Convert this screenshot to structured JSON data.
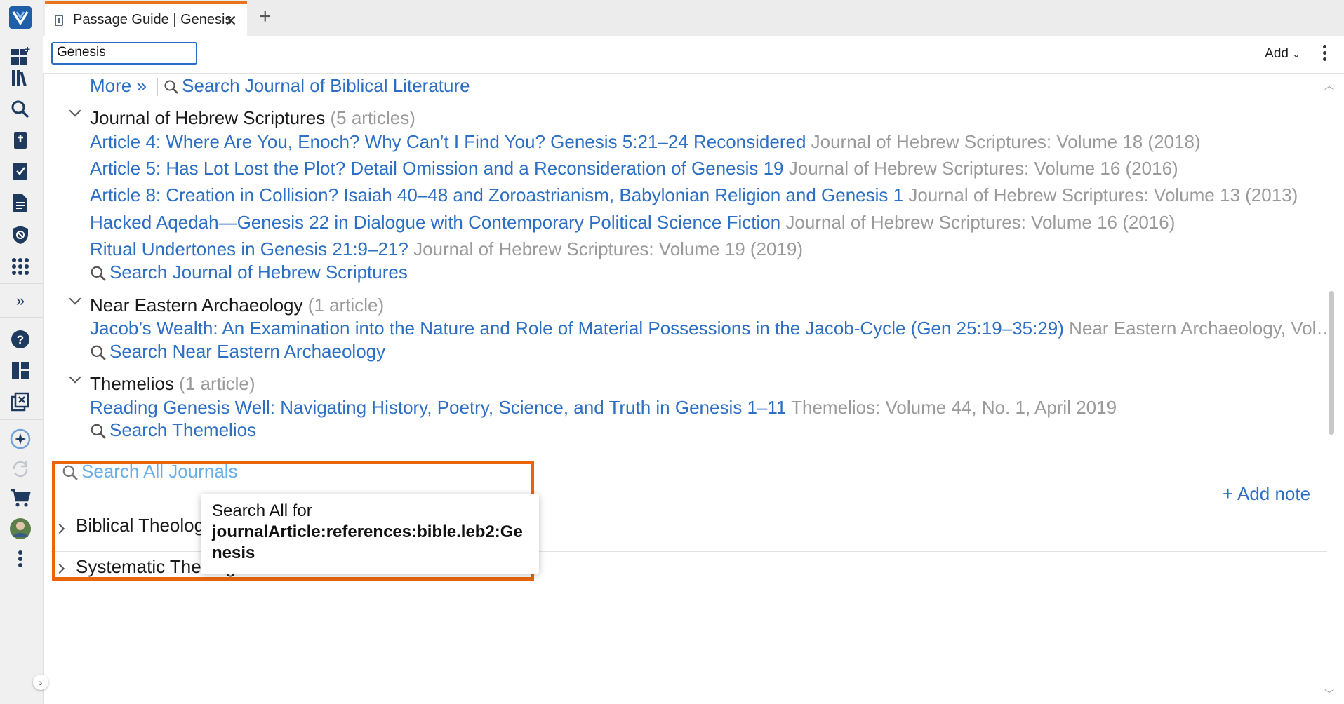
{
  "tab": {
    "title": "Passage Guide | Genesis",
    "close": "✕",
    "new_tab": "+"
  },
  "toolbar": {
    "reference": "Genesis",
    "add_label": "Add"
  },
  "content": {
    "jbl_more": "More »",
    "jbl_search": "Search Journal of Biblical Literature",
    "jhs": {
      "name": "Journal of Hebrew Scriptures",
      "count": "(5 articles)",
      "articles": [
        {
          "title": "Article 4: Where Are You, Enoch? Why Can’t I Find You? Genesis 5:21–24 Reconsidered",
          "source": "Journal of Hebrew Scriptures: Volume 18 (2018)"
        },
        {
          "title": "Article 5: Has Lot Lost the Plot? Detail Omission and a Reconsideration of Genesis 19",
          "source": "Journal of Hebrew Scriptures: Volume 16 (2016)"
        },
        {
          "title": "Article 8: Creation in Collision? Isaiah 40–48 and Zoroastrianism, Babylonian Religion and Genesis 1",
          "source": "Journal of Hebrew Scriptures: Volume 13 (2013)"
        },
        {
          "title": "Hacked Aqedah—Genesis 22 in Dialogue with Contemporary Political Science Fiction",
          "source": "Journal of Hebrew Scriptures: Volume 16 (2016)"
        },
        {
          "title": "Ritual Undertones in Genesis 21:9–21?",
          "source": "Journal of Hebrew Scriptures: Volume 19 (2019)"
        }
      ],
      "search": "Search Journal of Hebrew Scriptures"
    },
    "nea": {
      "name": "Near Eastern Archaeology",
      "count": "(1 article)",
      "article": {
        "title": "Jacob’s Wealth: An Examination into the Nature and Role of Material Possessions in the Jacob-Cycle (Gen 25:19–35:29)",
        "source": "Near Eastern Archaeology, Vol…"
      },
      "search": "Search Near Eastern Archaeology"
    },
    "them": {
      "name": "Themelios",
      "count": "(1 article)",
      "article": {
        "title": "Reading Genesis Well: Navigating History, Poetry, Science, and Truth in Genesis 1–11",
        "source": "Themelios: Volume 44, No. 1, April 2019"
      },
      "search": "Search Themelios"
    },
    "search_all": "Search All Journals",
    "add_note": "+ Add note",
    "tooltip_prefix": "Search All for",
    "tooltip_query": "journalArticle:references:bible.leb2:Genesis",
    "section_bt": "Biblical Theologies",
    "section_st": "Systematic Theologies"
  },
  "colors": {
    "accent": "#e8650c",
    "link": "#2c6fc3",
    "logo": "#1f5fa8"
  }
}
